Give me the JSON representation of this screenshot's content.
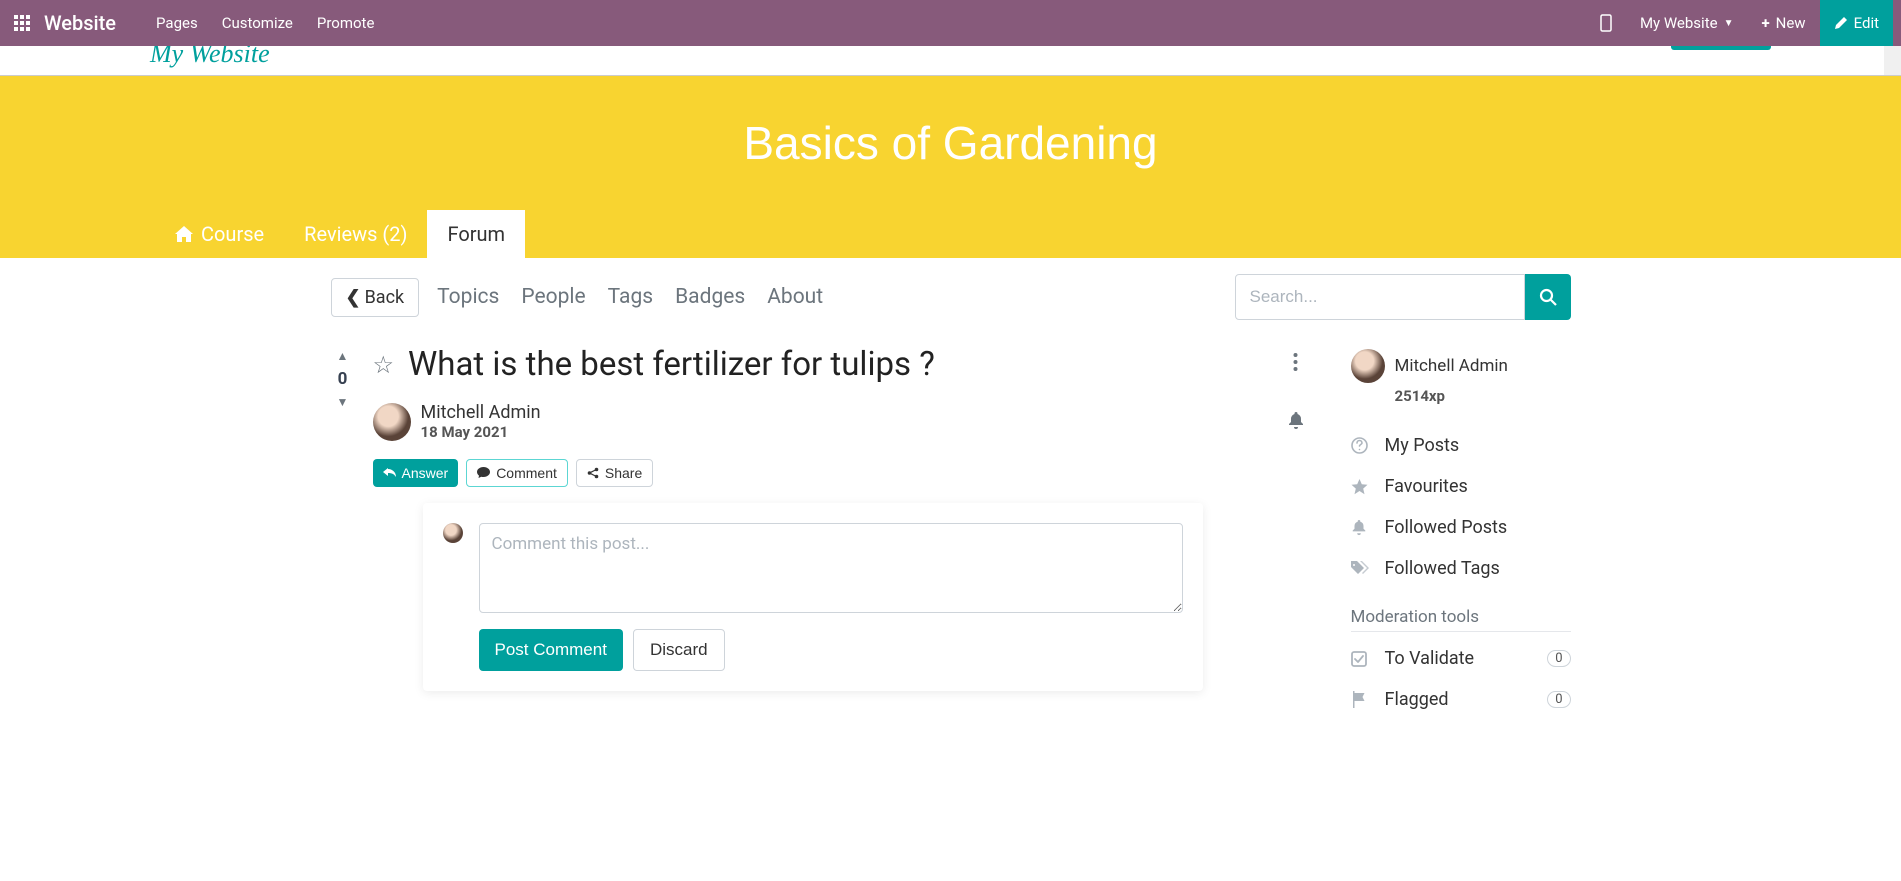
{
  "topbar": {
    "brand": "Website",
    "menu": {
      "pages": "Pages",
      "customize": "Customize",
      "promote": "Promote"
    },
    "site_selector": "My Website",
    "new_label": "New",
    "edit_label": "Edit"
  },
  "site_header": {
    "logo_text": "My Website"
  },
  "banner": {
    "title": "Basics of Gardening",
    "tabs": {
      "course": "Course",
      "reviews": "Reviews (2)",
      "forum": "Forum"
    }
  },
  "toolbar": {
    "back": "Back",
    "nav": {
      "topics": "Topics",
      "people": "People",
      "tags": "Tags",
      "badges": "Badges",
      "about": "About"
    },
    "search_placeholder": "Search..."
  },
  "post": {
    "vote_count": "0",
    "title": "What is the best fertilizer for tulips ?",
    "author": "Mitchell Admin",
    "date": "18 May 2021",
    "actions": {
      "answer": "Answer",
      "comment": "Comment",
      "share": "Share"
    },
    "comment_placeholder": "Comment this post...",
    "post_comment": "Post Comment",
    "discard": "Discard"
  },
  "sidebar": {
    "user_name": "Mitchell Admin",
    "user_xp": "2514xp",
    "items": {
      "my_posts": "My Posts",
      "favourites": "Favourites",
      "followed_posts": "Followed Posts",
      "followed_tags": "Followed Tags"
    },
    "moderation_header": "Moderation tools",
    "moderation": {
      "to_validate": "To Validate",
      "to_validate_count": "0",
      "flagged": "Flagged",
      "flagged_count": "0"
    }
  }
}
